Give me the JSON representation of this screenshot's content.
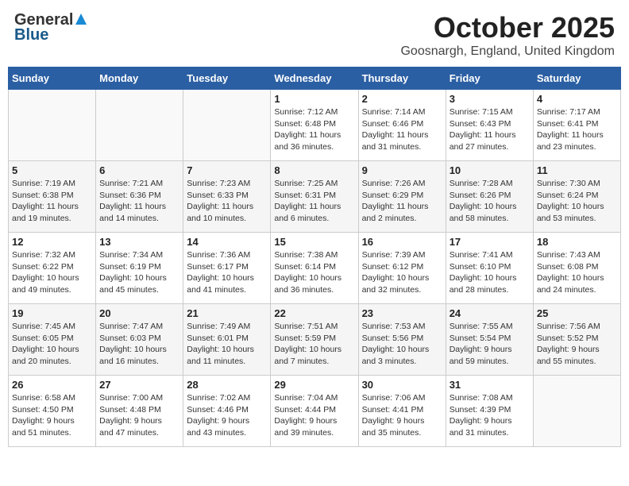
{
  "header": {
    "logo_general": "General",
    "logo_blue": "Blue",
    "month_title": "October 2025",
    "location": "Goosnargh, England, United Kingdom"
  },
  "days_of_week": [
    "Sunday",
    "Monday",
    "Tuesday",
    "Wednesday",
    "Thursday",
    "Friday",
    "Saturday"
  ],
  "weeks": [
    [
      {
        "day": "",
        "info": ""
      },
      {
        "day": "",
        "info": ""
      },
      {
        "day": "",
        "info": ""
      },
      {
        "day": "1",
        "info": "Sunrise: 7:12 AM\nSunset: 6:48 PM\nDaylight: 11 hours\nand 36 minutes."
      },
      {
        "day": "2",
        "info": "Sunrise: 7:14 AM\nSunset: 6:46 PM\nDaylight: 11 hours\nand 31 minutes."
      },
      {
        "day": "3",
        "info": "Sunrise: 7:15 AM\nSunset: 6:43 PM\nDaylight: 11 hours\nand 27 minutes."
      },
      {
        "day": "4",
        "info": "Sunrise: 7:17 AM\nSunset: 6:41 PM\nDaylight: 11 hours\nand 23 minutes."
      }
    ],
    [
      {
        "day": "5",
        "info": "Sunrise: 7:19 AM\nSunset: 6:38 PM\nDaylight: 11 hours\nand 19 minutes."
      },
      {
        "day": "6",
        "info": "Sunrise: 7:21 AM\nSunset: 6:36 PM\nDaylight: 11 hours\nand 14 minutes."
      },
      {
        "day": "7",
        "info": "Sunrise: 7:23 AM\nSunset: 6:33 PM\nDaylight: 11 hours\nand 10 minutes."
      },
      {
        "day": "8",
        "info": "Sunrise: 7:25 AM\nSunset: 6:31 PM\nDaylight: 11 hours\nand 6 minutes."
      },
      {
        "day": "9",
        "info": "Sunrise: 7:26 AM\nSunset: 6:29 PM\nDaylight: 11 hours\nand 2 minutes."
      },
      {
        "day": "10",
        "info": "Sunrise: 7:28 AM\nSunset: 6:26 PM\nDaylight: 10 hours\nand 58 minutes."
      },
      {
        "day": "11",
        "info": "Sunrise: 7:30 AM\nSunset: 6:24 PM\nDaylight: 10 hours\nand 53 minutes."
      }
    ],
    [
      {
        "day": "12",
        "info": "Sunrise: 7:32 AM\nSunset: 6:22 PM\nDaylight: 10 hours\nand 49 minutes."
      },
      {
        "day": "13",
        "info": "Sunrise: 7:34 AM\nSunset: 6:19 PM\nDaylight: 10 hours\nand 45 minutes."
      },
      {
        "day": "14",
        "info": "Sunrise: 7:36 AM\nSunset: 6:17 PM\nDaylight: 10 hours\nand 41 minutes."
      },
      {
        "day": "15",
        "info": "Sunrise: 7:38 AM\nSunset: 6:14 PM\nDaylight: 10 hours\nand 36 minutes."
      },
      {
        "day": "16",
        "info": "Sunrise: 7:39 AM\nSunset: 6:12 PM\nDaylight: 10 hours\nand 32 minutes."
      },
      {
        "day": "17",
        "info": "Sunrise: 7:41 AM\nSunset: 6:10 PM\nDaylight: 10 hours\nand 28 minutes."
      },
      {
        "day": "18",
        "info": "Sunrise: 7:43 AM\nSunset: 6:08 PM\nDaylight: 10 hours\nand 24 minutes."
      }
    ],
    [
      {
        "day": "19",
        "info": "Sunrise: 7:45 AM\nSunset: 6:05 PM\nDaylight: 10 hours\nand 20 minutes."
      },
      {
        "day": "20",
        "info": "Sunrise: 7:47 AM\nSunset: 6:03 PM\nDaylight: 10 hours\nand 16 minutes."
      },
      {
        "day": "21",
        "info": "Sunrise: 7:49 AM\nSunset: 6:01 PM\nDaylight: 10 hours\nand 11 minutes."
      },
      {
        "day": "22",
        "info": "Sunrise: 7:51 AM\nSunset: 5:59 PM\nDaylight: 10 hours\nand 7 minutes."
      },
      {
        "day": "23",
        "info": "Sunrise: 7:53 AM\nSunset: 5:56 PM\nDaylight: 10 hours\nand 3 minutes."
      },
      {
        "day": "24",
        "info": "Sunrise: 7:55 AM\nSunset: 5:54 PM\nDaylight: 9 hours\nand 59 minutes."
      },
      {
        "day": "25",
        "info": "Sunrise: 7:56 AM\nSunset: 5:52 PM\nDaylight: 9 hours\nand 55 minutes."
      }
    ],
    [
      {
        "day": "26",
        "info": "Sunrise: 6:58 AM\nSunset: 4:50 PM\nDaylight: 9 hours\nand 51 minutes."
      },
      {
        "day": "27",
        "info": "Sunrise: 7:00 AM\nSunset: 4:48 PM\nDaylight: 9 hours\nand 47 minutes."
      },
      {
        "day": "28",
        "info": "Sunrise: 7:02 AM\nSunset: 4:46 PM\nDaylight: 9 hours\nand 43 minutes."
      },
      {
        "day": "29",
        "info": "Sunrise: 7:04 AM\nSunset: 4:44 PM\nDaylight: 9 hours\nand 39 minutes."
      },
      {
        "day": "30",
        "info": "Sunrise: 7:06 AM\nSunset: 4:41 PM\nDaylight: 9 hours\nand 35 minutes."
      },
      {
        "day": "31",
        "info": "Sunrise: 7:08 AM\nSunset: 4:39 PM\nDaylight: 9 hours\nand 31 minutes."
      },
      {
        "day": "",
        "info": ""
      }
    ]
  ]
}
